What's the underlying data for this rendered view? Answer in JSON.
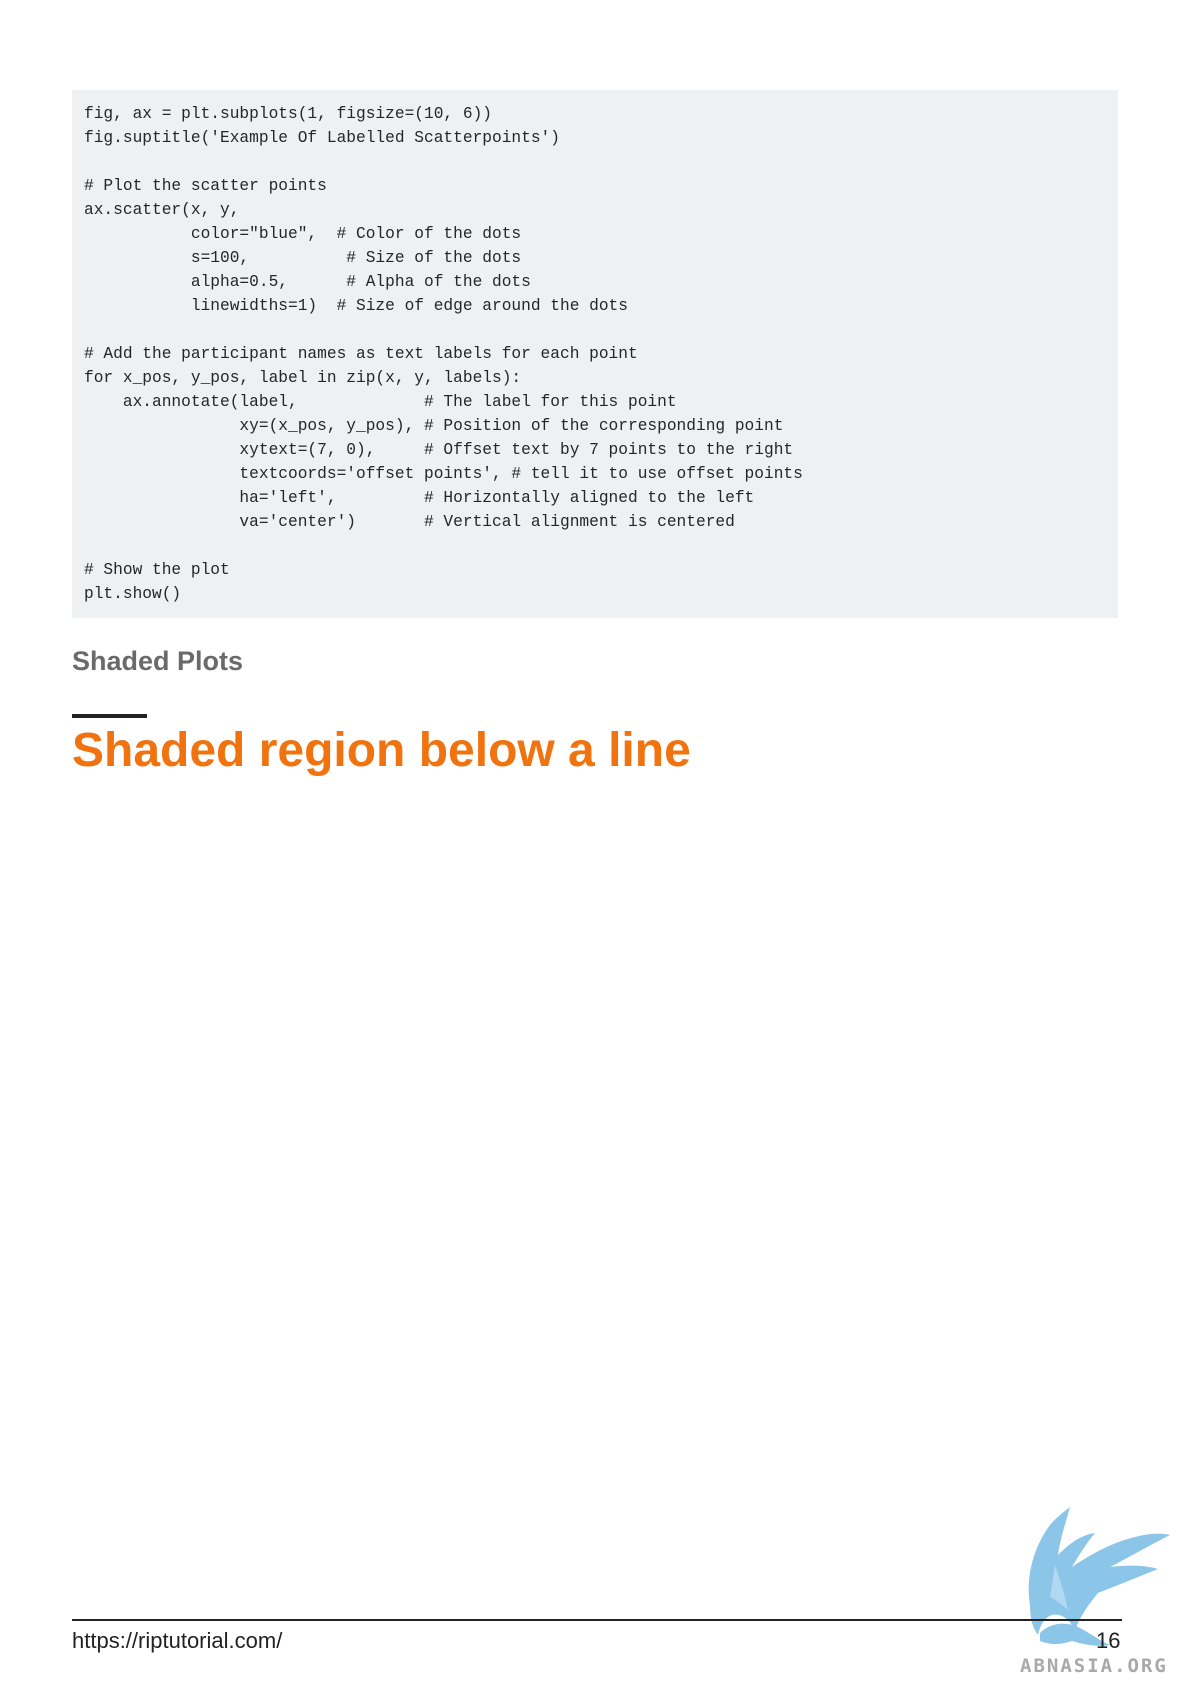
{
  "code": {
    "lines": [
      "fig, ax = plt.subplots(1, figsize=(10, 6))",
      "fig.suptitle('Example Of Labelled Scatterpoints')",
      "",
      "# Plot the scatter points",
      "ax.scatter(x, y,",
      "           color=\"blue\",  # Color of the dots",
      "           s=100,          # Size of the dots",
      "           alpha=0.5,      # Alpha of the dots",
      "           linewidths=1)  # Size of edge around the dots",
      "",
      "# Add the participant names as text labels for each point",
      "for x_pos, y_pos, label in zip(x, y, labels):",
      "    ax.annotate(label,             # The label for this point",
      "                xy=(x_pos, y_pos), # Position of the corresponding point",
      "                xytext=(7, 0),     # Offset text by 7 points to the right",
      "                textcoords='offset points', # tell it to use offset points",
      "                ha='left',         # Horizontally aligned to the left",
      "                va='center')       # Vertical alignment is centered",
      "",
      "# Show the plot",
      "plt.show()"
    ]
  },
  "section": {
    "title": "Shaded Plots"
  },
  "heading": {
    "title": "Shaded region below a line"
  },
  "footer": {
    "url": "https://riptutorial.com/",
    "page_number": "16"
  },
  "watermark": {
    "text": "ABNASIA.ORG",
    "icon": "griffin-logo-icon",
    "color": "#7fbfe6"
  },
  "colors": {
    "heading": "#f0730f",
    "section_title": "#6a6a6a",
    "code_background": "#eff0f1"
  }
}
